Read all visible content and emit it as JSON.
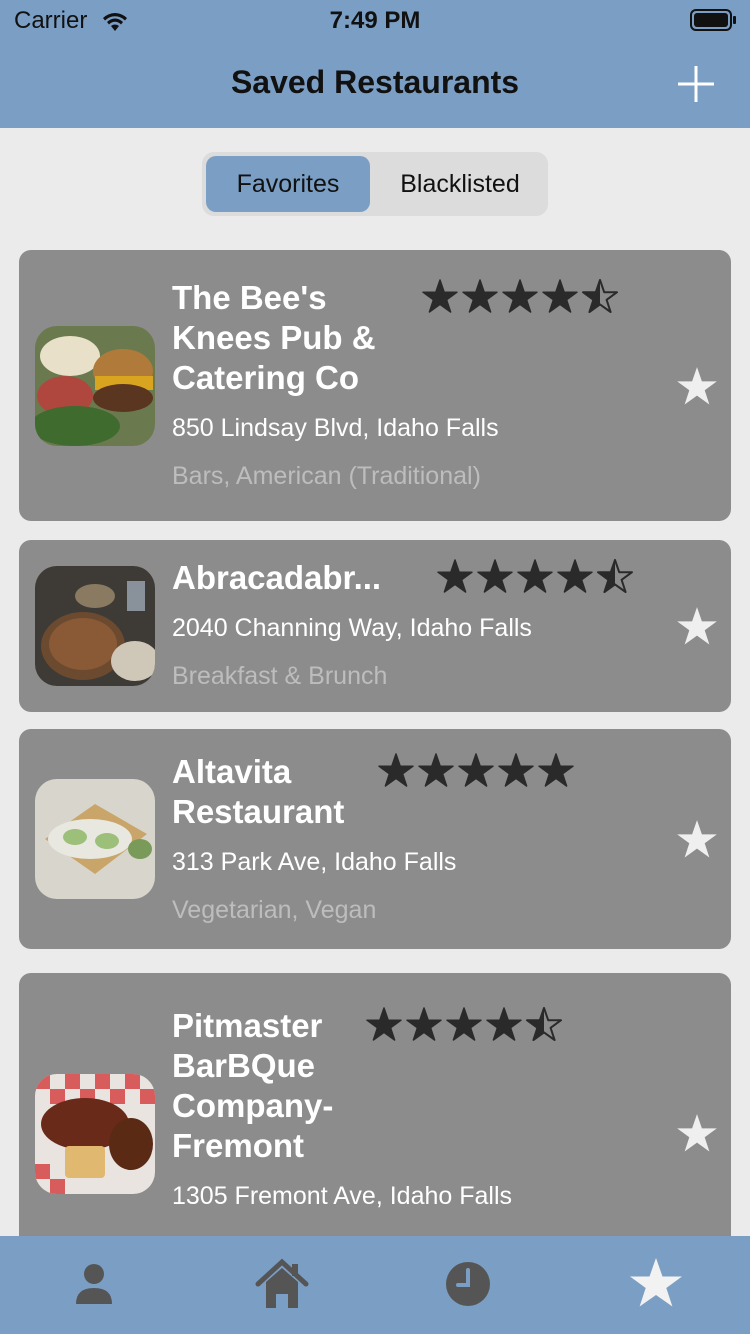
{
  "status": {
    "carrier": "Carrier",
    "time": "7:49 PM"
  },
  "nav": {
    "title": "Saved Restaurants",
    "add_icon": "plus-icon"
  },
  "segment": {
    "options": [
      "Favorites",
      "Blacklisted"
    ],
    "selected": "Favorites"
  },
  "restaurants": [
    {
      "name": "The Bee's Knees Pub & Catering Co",
      "rating": 4.5,
      "address": "850 Lindsay Blvd, Idaho Falls",
      "categories": "Bars, American (Traditional)"
    },
    {
      "name": "Abracadabr...",
      "rating": 4.5,
      "address": "2040 Channing Way, Idaho Falls",
      "categories": "Breakfast & Brunch"
    },
    {
      "name": "Altavita Restaurant",
      "rating": 5,
      "address": "313 Park Ave, Idaho Falls",
      "categories": "Vegetarian, Vegan"
    },
    {
      "name": "Pitmaster BarBQue Company-Fremont",
      "rating": 4.5,
      "address": "1305 Fremont Ave, Idaho Falls",
      "categories": ""
    }
  ],
  "tabs": [
    "profile-icon",
    "home-icon",
    "history-icon",
    "favorites-star-icon"
  ],
  "colors": {
    "accent": "#7b9ec4",
    "card": "#8c8c8c",
    "background": "#ebebeb"
  }
}
